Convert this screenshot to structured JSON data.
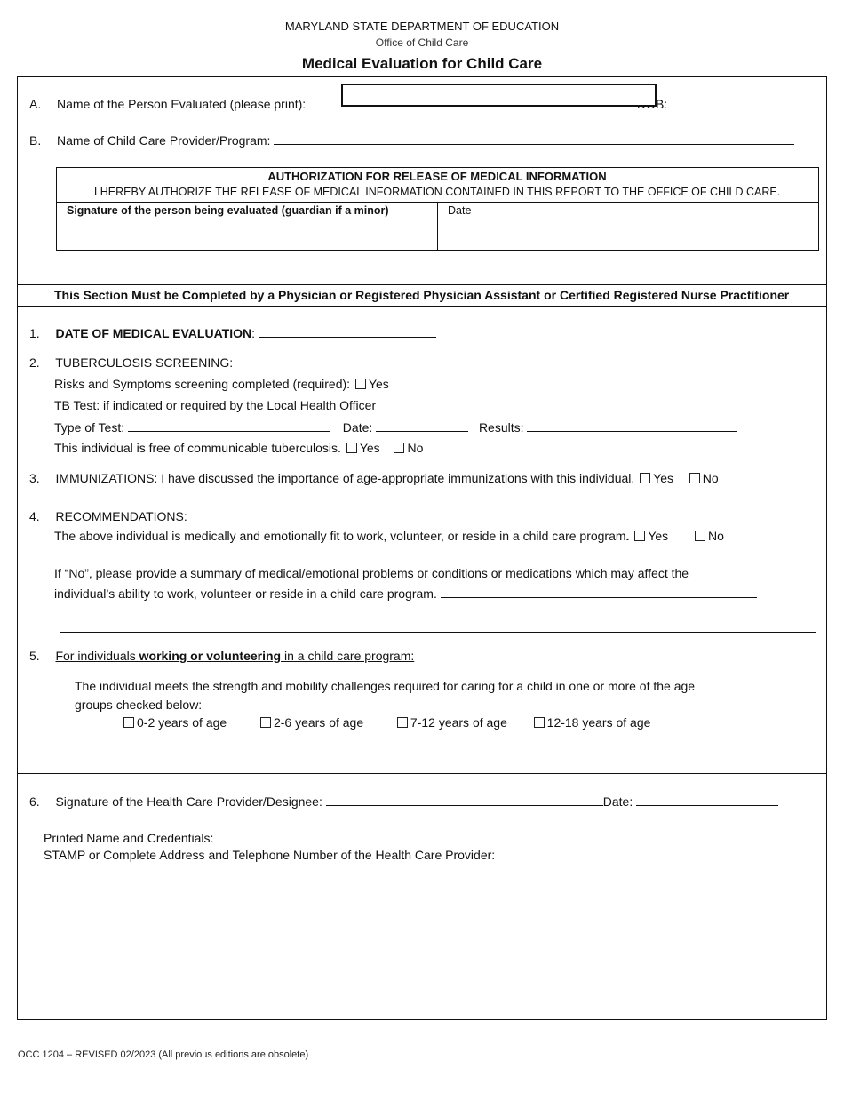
{
  "header": {
    "agency": "MARYLAND STATE DEPARTMENT OF EDUCATION",
    "office": "Office of Child Care",
    "title": "Medical Evaluation for Child Care"
  },
  "section_a": {
    "marker": "A.",
    "label": "Name of the Person Evaluated (please print):",
    "name_value": "",
    "dob_label": "DOB:"
  },
  "section_b": {
    "marker": "B.",
    "label": "Name of Child Care Provider/Program:"
  },
  "authorization": {
    "title": "AUTHORIZATION FOR RELEASE OF MEDICAL INFORMATION",
    "text": "I HEREBY AUTHORIZE THE RELEASE OF MEDICAL INFORMATION CONTAINED IN THIS REPORT TO THE OFFICE OF CHILD CARE.",
    "signature_label": "Signature of the person being evaluated (guardian if a minor)",
    "date_label": "Date"
  },
  "provider_section_title": "This Section Must be Completed by a Physician or Registered Physician Assistant or Certified Registered Nurse Practitioner",
  "item1": {
    "number": "1.",
    "label": "DATE OF MEDICAL EVALUATION",
    "colon": ":"
  },
  "item2": {
    "number": "2.",
    "label": "TUBERCULOSIS SCREENING:",
    "risks_label": "Risks and Symptoms screening completed (required):",
    "risks_yes": "Yes",
    "tb_test_label": "TB Test: if indicated or required by the Local Health Officer",
    "type_label": "Type of Test:",
    "date_label": "Date:",
    "results_label": "Results:",
    "free_label": "This individual is free of communicable tuberculosis.",
    "yes": "Yes",
    "no": "No"
  },
  "item3": {
    "number": "3.",
    "label": "IMMUNIZATIONS:  I have discussed the importance of age-appropriate immunizations with this individual.",
    "yes": "Yes",
    "no": "No"
  },
  "item4": {
    "number": "4.",
    "label": "RECOMMENDATIONS:",
    "fit_label": "The above individual is medically and emotionally fit to work, volunteer, or reside in a child care program",
    "fit_period": ".",
    "yes": "Yes",
    "no": "No",
    "if_no_line1": "If “No”, please provide a summary of medical/emotional problems or conditions or medications which may affect the",
    "if_no_line2": "individual’s ability to work, volunteer or reside in a child care program."
  },
  "item5": {
    "number": "5.",
    "label_pre": "For individuals ",
    "label_bold": "working or volunteering",
    "label_post": " in a child care program:",
    "desc_line1": "The individual meets the strength and mobility challenges required for caring for a child in one or more of the age",
    "desc_line2": "groups checked below:",
    "age_groups": [
      "0-2 years of age",
      "2-6 years of age",
      "7-12 years of age",
      "12-18 years of age"
    ]
  },
  "item6": {
    "number": "6.",
    "signature_label": "Signature of the Health Care Provider/Designee:",
    "date_label": "Date:",
    "printed_name_label": "Printed Name and Credentials:",
    "stamp_label": "STAMP or Complete Address and Telephone Number of the Health Care Provider:"
  },
  "footer": "OCC 1204 – REVISED 02/2023 (All previous editions are obsolete)"
}
